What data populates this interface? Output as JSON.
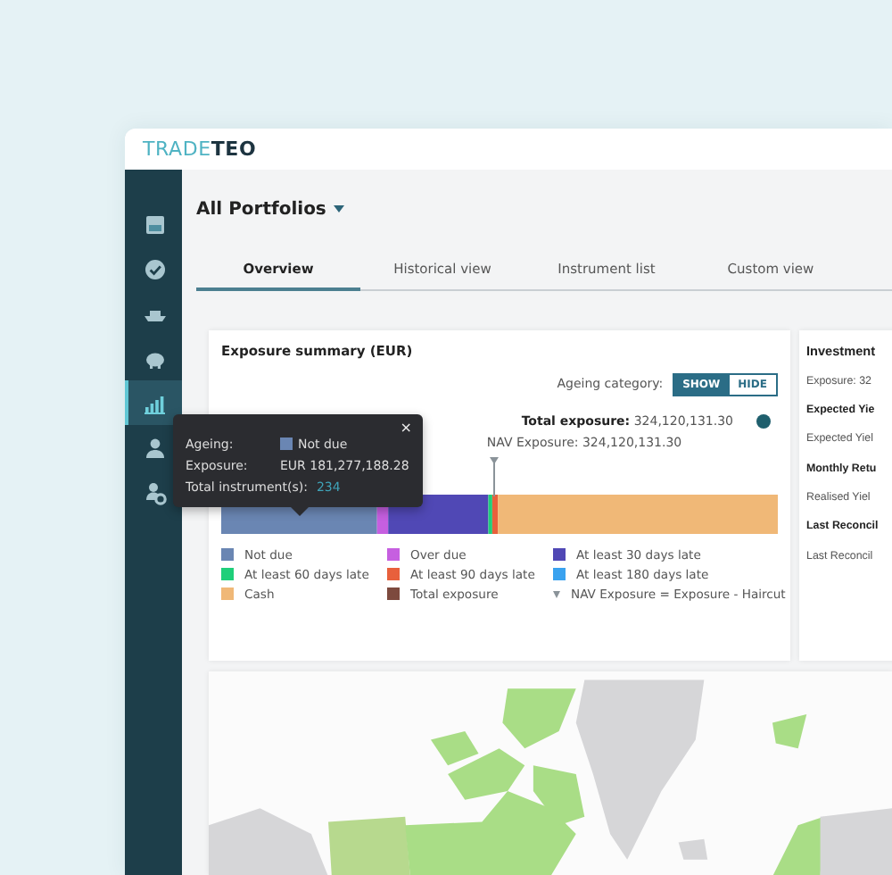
{
  "header": {
    "logo": [
      "TRADE",
      "TEO"
    ]
  },
  "sidebar": {
    "items": [
      {
        "selected": false
      },
      {
        "selected": false
      },
      {
        "selected": false
      },
      {
        "selected": false
      },
      {
        "selected": true
      },
      {
        "selected": false
      },
      {
        "selected": false
      }
    ]
  },
  "page_title": "All Portfolios",
  "tabs": [
    {
      "label": "Overview",
      "selected": true
    },
    {
      "label": "Historical view",
      "selected": false
    },
    {
      "label": "Instrument list",
      "selected": false
    },
    {
      "label": "Custom view",
      "selected": false
    }
  ],
  "exposure_card": {
    "title": "Exposure summary (EUR)",
    "ageing_label": "Ageing category:",
    "ageing_toggle": [
      {
        "label": "SHOW",
        "selected": true
      },
      {
        "label": "HIDE",
        "selected": false
      }
    ],
    "total_label": "Total exposure:",
    "total_value": "324,120,131.30",
    "nav_marker": {
      "label": "NAV Exposure: 324,120,131.30",
      "level": 0.49
    },
    "legend": [
      {
        "kind": "swatch",
        "label": "Not due",
        "color": "#6a86b3"
      },
      {
        "kind": "swatch",
        "label": "Over due",
        "color": "#c65fe0"
      },
      {
        "kind": "swatch",
        "label": "At least 30 days late",
        "color": "#5048b5"
      },
      {
        "kind": "swatch",
        "label": "At least 60 days late",
        "color": "#1fcf7a"
      },
      {
        "kind": "swatch",
        "label": "At least 90 days late",
        "color": "#e8603c"
      },
      {
        "kind": "swatch",
        "label": "At least 180 days late",
        "color": "#3aa2ef"
      },
      {
        "kind": "swatch",
        "label": "Cash",
        "color": "#f0b877"
      },
      {
        "kind": "swatch",
        "label": "Total exposure",
        "color": "#7d4a3e"
      },
      {
        "kind": "marker",
        "label": "NAV Exposure = Exposure - Haircut",
        "color": "#8a9399"
      }
    ],
    "tooltip": {
      "close": "×",
      "rows": [
        {
          "label": "Ageing:",
          "value": "Not due",
          "color": "#6a86b3"
        },
        {
          "label": "Exposure:",
          "value": "EUR 181,277,188.28"
        },
        {
          "label": "Total instrument(s):",
          "value": "234",
          "kind": "link"
        }
      ]
    }
  },
  "investment_card": {
    "title": "Investment",
    "rows": [
      {
        "text": "Exposure: 32",
        "bold": false
      },
      {
        "text": "Expected Yie",
        "bold": true
      },
      {
        "text": "Expected Yiel",
        "bold": false
      },
      {
        "text": "Monthly Retu",
        "bold": true
      },
      {
        "text": "Realised Yiel",
        "bold": false
      },
      {
        "text": "Last Reconcil",
        "bold": true
      },
      {
        "text": "Last Reconcil",
        "bold": false
      }
    ]
  }
}
